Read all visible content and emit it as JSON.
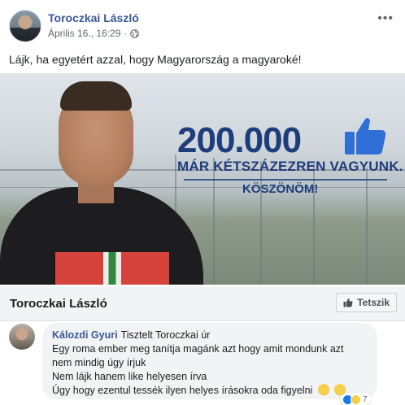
{
  "post": {
    "author": "Toroczkai László",
    "timestamp": "Április 16., 16:29",
    "separator": "·",
    "text": "Lájk, ha egyetért azzal, hogy Magyarország a magyaroké!"
  },
  "banner": {
    "count": "200.000",
    "tagline": "MÁR KÉTSZÁZEZREN VAGYUNK.",
    "thanks": "KÖSZÖNÖM!",
    "colors": {
      "headline": "#1e3d7a",
      "like_icon": "#2f6fd6"
    }
  },
  "page_bar": {
    "name": "Toroczkai László",
    "like_label": "Tetszik"
  },
  "comment": {
    "author": "Kálozdi Gyuri",
    "lines": [
      "Tisztelt Toroczkai úr",
      "Egy roma ember meg tanítja magánk azt hogy amit mondunk azt",
      "nem mindig úgy írjuk",
      "Nem lájk hanem like helyesen írva",
      "Úgy hogy ezentul tessék ilyen helyes írásokra oda figyelni"
    ],
    "reaction_count": "7"
  },
  "colors": {
    "link": "#385898",
    "meta": "#616770",
    "bar_bg": "#f2f3f5"
  }
}
